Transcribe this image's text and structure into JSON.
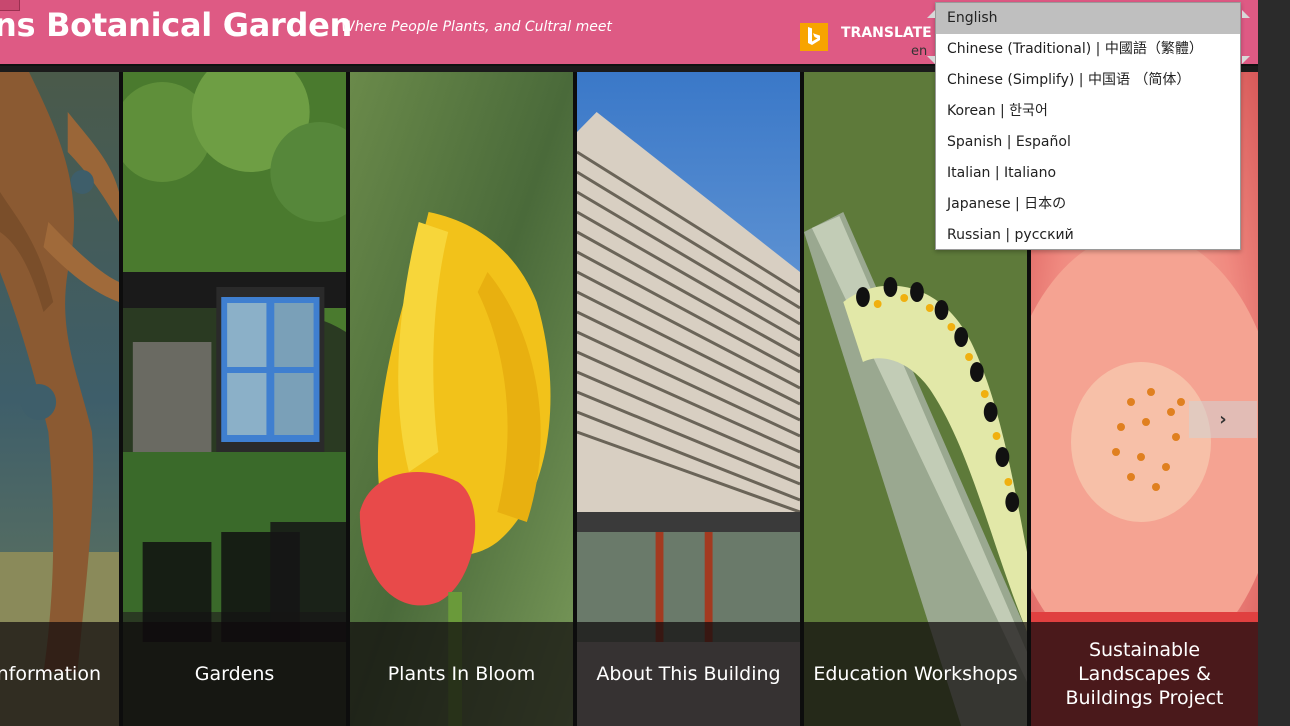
{
  "header": {
    "title": "ns Botanical Garden",
    "tagline": "Where People Plants, and Cultral meet",
    "translate_label": "TRANSLATE",
    "lang_code": "en"
  },
  "language_dropdown": {
    "options": [
      "English",
      "Chinese (Traditional) | 中國語（繁體）",
      "Chinese (Simplify) | 中国语 （简体）",
      "Korean | 한국어",
      "Spanish | Español",
      "Italian | Italiano",
      "Japanese | 日本の",
      "Russian | русский"
    ],
    "selected": "English"
  },
  "panels": [
    {
      "label": "Information",
      "visible_label": "nformation",
      "image": "sculpture-tree"
    },
    {
      "label": "Gardens",
      "image": "garden-window-chairs"
    },
    {
      "label": "Plants In Bloom",
      "image": "yellow-tulip"
    },
    {
      "label": "About This Building",
      "image": "building-louvers"
    },
    {
      "label": "Education Workshops",
      "image": "caterpillar"
    },
    {
      "label": "Sustainable Landscapes & Buildings Project",
      "image": "pink-flower"
    }
  ],
  "icons": {
    "bing": "bing-logo-icon",
    "next": "chevron-right-icon"
  },
  "colors": {
    "header_bg": "#de5a84",
    "bing_orange": "#f7a400",
    "dropdown_selected": "#bfbfbf"
  }
}
